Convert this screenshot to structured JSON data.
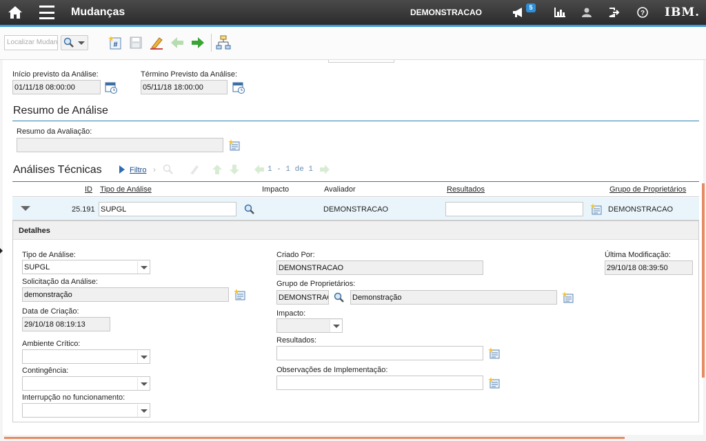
{
  "header": {
    "title": "Mudanças",
    "user": "DEMONSTRACAO",
    "notification_count": "5",
    "brand": "IBM.",
    "accent": "#3a9ad9"
  },
  "toolbar": {
    "search_placeholder": "Localizar Mudança"
  },
  "analysis": {
    "start_label": "Início previsto da Análise:",
    "start_value": "01/11/18 08:00:00",
    "end_label": "Término Previsto da Análise:",
    "end_value": "05/11/18 18:00:00"
  },
  "summary": {
    "section_title": "Resumo de Análise",
    "eval_label": "Resumo da Avaliação:",
    "eval_value": ""
  },
  "technical": {
    "section_title": "Análises Técnicas",
    "filter_label": "Filtro",
    "pagination": "1 - 1 de 1",
    "columns": [
      "ID",
      "Tipo de Análise",
      "Impacto",
      "Avaliador",
      "Resultados",
      "Grupo de Proprietários"
    ],
    "row": {
      "id": "25.191",
      "type": "SUPGL",
      "impact": "",
      "evaluator": "DEMONSTRACAO",
      "results": "",
      "owner_group": "DEMONSTRACAO"
    }
  },
  "details": {
    "title": "Detalhes",
    "type_label": "Tipo de Análise:",
    "type_value": "SUPGL",
    "request_label": "Solicitação da Análise:",
    "request_value": "demonstração",
    "created_date_label": "Data de Criação:",
    "created_date_value": "29/10/18 08:19:13",
    "critical_env_label": "Ambiente Crítico:",
    "critical_env_value": "",
    "contingency_label": "Contingência:",
    "contingency_value": "",
    "interruption_label": "Interrupção no funcionamento:",
    "interruption_value": "",
    "created_by_label": "Criado Por:",
    "created_by_value": "DEMONSTRACAO",
    "owner_group_label": "Grupo de Proprietários:",
    "owner_group_code": "DEMONSTRACAO",
    "owner_group_desc": "Demonstração",
    "impact_label": "Impacto:",
    "impact_value": "",
    "results_label": "Resultados:",
    "results_value": "",
    "impl_notes_label": "Observações de Implementação:",
    "impl_notes_value": "",
    "last_mod_label": "Última Modificação:",
    "last_mod_value": "29/10/18 08:39:50"
  }
}
